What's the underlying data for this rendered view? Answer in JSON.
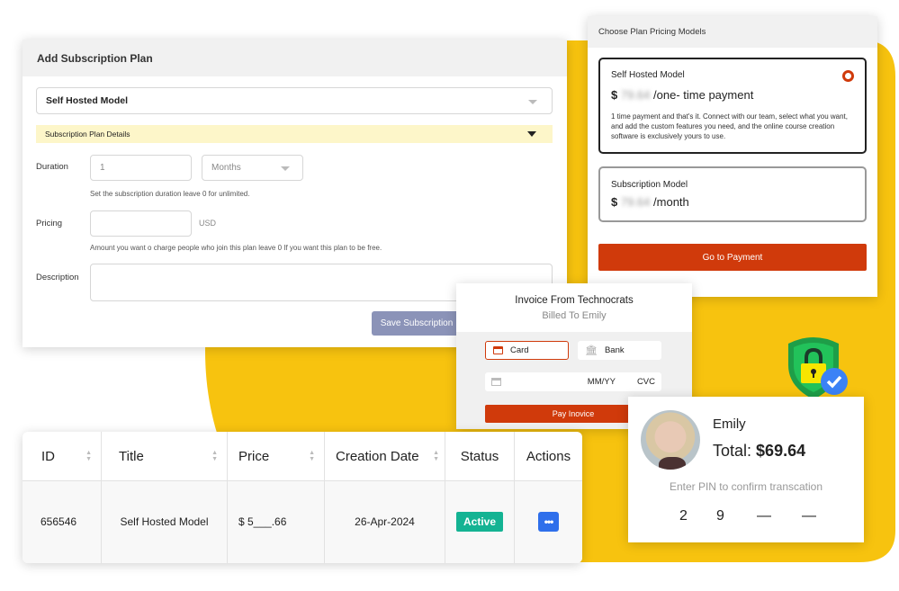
{
  "colors": {
    "accent": "#D03A0B",
    "yellow": "#F7C30F",
    "active": "#14B393",
    "actions": "#2F6FEB",
    "save": "#8B93B8"
  },
  "subscription_form": {
    "title": "Add Subscription Plan",
    "model_select": "Self Hosted Model",
    "details_label": "Subscription Plan Details",
    "duration_label": "Duration",
    "duration_value": "1",
    "duration_unit": "Months",
    "duration_hint": "Set the subscription duration leave 0 for unlimited.",
    "pricing_label": "Pricing",
    "pricing_value": "",
    "currency": "USD",
    "pricing_hint": "Amount you want o charge people who join this plan leave 0 If you want this plan to be free.",
    "description_label": "Description",
    "description_value": "",
    "save_label": "Save Subscription"
  },
  "pricing_models": {
    "title": "Choose Plan Pricing Models",
    "options": [
      {
        "name": "Self Hosted Model",
        "currency": "$",
        "price": "79.64",
        "period": "/one- time payment",
        "description": "1 time payment and that's it. Connect with our team, select what you want, and add the custom features you need, and the online course creation software is exclusively yours to use.",
        "selected": true
      },
      {
        "name": "Subscription Model",
        "currency": "$",
        "price": "79.64",
        "period": "/month",
        "selected": false
      }
    ],
    "button": "Go to Payment"
  },
  "invoice": {
    "title": "Invoice From Technocrats",
    "subtitle": "Billed To Emily",
    "tab_card": "Card",
    "tab_bank": "Bank",
    "expiry_placeholder": "MM/YY",
    "cvc_placeholder": "CVC",
    "pay_button": "Pay Inovice"
  },
  "table": {
    "headers": [
      "ID",
      "Title",
      "Price",
      "Creation Date",
      "Status",
      "Actions"
    ],
    "row": {
      "id": "656546",
      "title": "Self Hosted Model",
      "price": "$ 5___.66",
      "date": "26-Apr-2024",
      "status": "Active"
    }
  },
  "pin_card": {
    "name": "Emily",
    "total_label": "Total:",
    "total_value": "$69.64",
    "prompt": "Enter PIN to confirm transcation",
    "pin": [
      "2",
      "9",
      "—",
      "—"
    ]
  }
}
